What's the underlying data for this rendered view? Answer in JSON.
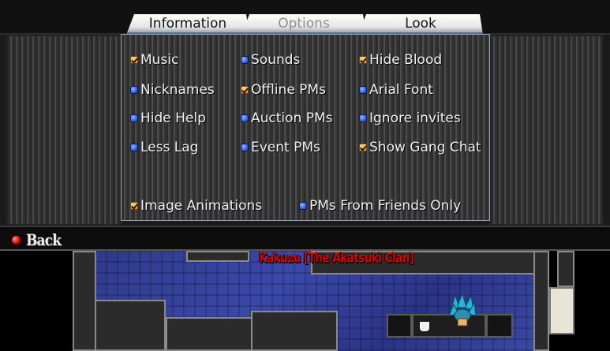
{
  "tabs": [
    {
      "label": "Information",
      "active": true
    },
    {
      "label": "Options",
      "active": false
    },
    {
      "label": "Look",
      "active": true
    }
  ],
  "options": {
    "col1": [
      {
        "label": "Music",
        "checked": true
      },
      {
        "label": "Nicknames",
        "checked": false
      },
      {
        "label": "Hide Help",
        "checked": false
      },
      {
        "label": "Less Lag",
        "checked": false
      }
    ],
    "col2": [
      {
        "label": "Sounds",
        "checked": false
      },
      {
        "label": "Offline PMs",
        "checked": true
      },
      {
        "label": "Auction PMs",
        "checked": false
      },
      {
        "label": "Event PMs",
        "checked": false
      }
    ],
    "col3": [
      {
        "label": "Hide Blood",
        "checked": true
      },
      {
        "label": "Arial Font",
        "checked": false
      },
      {
        "label": "Ignore invites",
        "checked": false
      },
      {
        "label": "Show Gang Chat",
        "checked": true
      }
    ],
    "bottom": [
      {
        "label": "Image Animations",
        "checked": true
      },
      {
        "label": "PMs From Friends Only",
        "checked": false
      }
    ]
  },
  "back": {
    "label": "Back"
  },
  "map": {
    "character_name": "Kakuzu [The Akatsuki Clan]"
  },
  "colors": {
    "checked": "#e8a040",
    "unchecked": "#2f5be0",
    "name_text": "#d80000"
  }
}
